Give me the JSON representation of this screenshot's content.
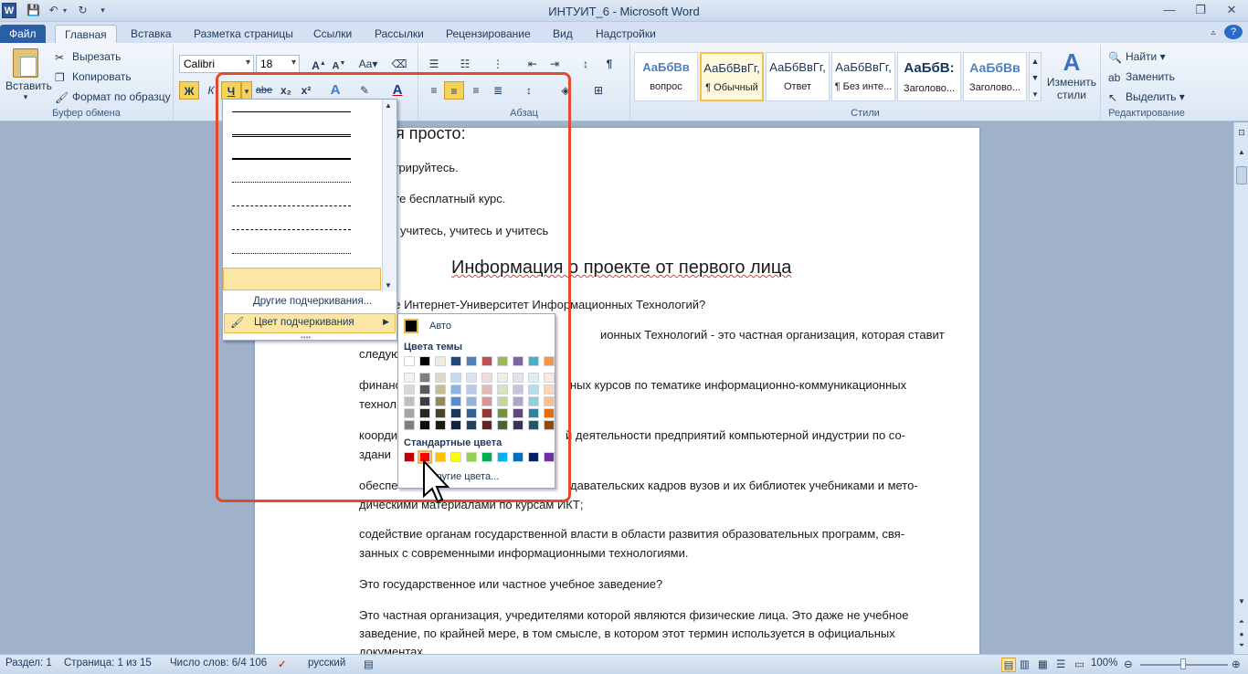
{
  "window": {
    "title": "ИНТУИТ_6 - Microsoft Word",
    "logo": "W"
  },
  "tabs": [
    {
      "label": "Файл",
      "kind": "file"
    },
    {
      "label": "Главная",
      "kind": "active"
    },
    {
      "label": "Вставка"
    },
    {
      "label": "Разметка страницы"
    },
    {
      "label": "Ссылки"
    },
    {
      "label": "Рассылки"
    },
    {
      "label": "Рецензирование"
    },
    {
      "label": "Вид"
    },
    {
      "label": "Надстройки"
    }
  ],
  "clipboard": {
    "paste": "Вставить",
    "cut": "Вырезать",
    "copy": "Копировать",
    "format_painter": "Формат по образцу",
    "group": "Буфер обмена"
  },
  "font": {
    "name": "Calibri",
    "size": "18",
    "bold": "Ж",
    "italic": "К",
    "underline": "Ч",
    "strike": "abe",
    "sub": "x₂",
    "sup": "x²"
  },
  "paragraph": {
    "group": "Абзац"
  },
  "styles": {
    "group": "Стили",
    "items": [
      {
        "sample": "АаБбВв",
        "name": "вопрос"
      },
      {
        "sample": "АаБбВвГг,",
        "name": "¶ Обычный",
        "selected": true
      },
      {
        "sample": "АаБбВвГг,",
        "name": "Ответ"
      },
      {
        "sample": "АаБбВвГг,",
        "name": "¶ Без инте..."
      },
      {
        "sample": "АаБбВ:",
        "name": "Заголово..."
      },
      {
        "sample": "АаБбВв",
        "name": "Заголово..."
      }
    ],
    "change_label_1": "Изменить",
    "change_label_2": "стили"
  },
  "editing": {
    "find": "Найти",
    "replace": "Заменить",
    "select": "Выделить",
    "group": "Редактирование"
  },
  "document": {
    "lines": [
      {
        "text": "ся просто:",
        "size": 18
      },
      {
        "text": "стрируйтесь."
      },
      {
        "text": "ите бесплатный курс."
      },
      {
        "text": "ь, учитесь, учитесь и учитесь"
      },
      {
        "text": "ое Интернет-Университет Информационных Технологий?"
      },
      {
        "text": "ионных Технологий - это частная организация, которая ставит"
      },
      {
        "text": "следую"
      },
      {
        "text": "финанс"
      },
      {
        "text": "ных курсов по тематике информационно-коммуникационных"
      },
      {
        "text": "технол"
      },
      {
        "text": "коорди"
      },
      {
        "text": "й деятельности предприятий компьютерной индустрии по со-"
      },
      {
        "text": "здани"
      },
      {
        "text": "обеспе"
      },
      {
        "text": "давательских кадров вузов и их библиотек учебниками и мето-"
      },
      {
        "text": "дическими материалами по курсам ИКТ;"
      },
      {
        "text": "содействие органам государственной власти в области развития образовательных программ, свя-"
      },
      {
        "text": "занных с современными информационными технологиями."
      },
      {
        "text": "Это государственное или частное учебное заведение?"
      },
      {
        "text": "Это частная организация, учредителями которой являются физические лица. Это даже не учебное"
      },
      {
        "text": "заведение, по крайней мере, в том смысле, в котором этот термин используется в официальных"
      },
      {
        "text": "документах"
      }
    ],
    "heading": "Информация о проекте от первого лица"
  },
  "underline_menu": {
    "more": "Другие подчеркивания...",
    "color": "Цвет подчеркивания"
  },
  "color_menu": {
    "auto": "Авто",
    "theme_title": "Цвета темы",
    "standard_title": "Стандартные цвета",
    "more": "Другие цвета...",
    "theme_top": [
      "#ffffff",
      "#000000",
      "#eeece1",
      "#1f497d",
      "#4f81bd",
      "#c0504d",
      "#9bbb59",
      "#8064a2",
      "#4bacc6",
      "#f79646"
    ],
    "theme_shades": [
      [
        "#f2f2f2",
        "#7f7f7f",
        "#ddd9c3",
        "#c6d9f0",
        "#dbe5f1",
        "#f2dcdb",
        "#ebf1dd",
        "#e5e0ec",
        "#dbeef3",
        "#fdeada"
      ],
      [
        "#d8d8d8",
        "#595959",
        "#c4bd97",
        "#8db3e2",
        "#b8cce4",
        "#e5b9b7",
        "#d7e3bc",
        "#ccc1d9",
        "#b7dde8",
        "#fbd5b5"
      ],
      [
        "#bfbfbf",
        "#3f3f3f",
        "#938953",
        "#548dd4",
        "#95b3d7",
        "#d99694",
        "#c3d69b",
        "#b2a2c7",
        "#92cddc",
        "#fac08f"
      ],
      [
        "#a5a5a5",
        "#262626",
        "#494429",
        "#17365d",
        "#366092",
        "#953734",
        "#76923c",
        "#5f497a",
        "#31859b",
        "#e36c09"
      ],
      [
        "#7f7f7f",
        "#0c0c0c",
        "#1d1b10",
        "#0f243e",
        "#244061",
        "#632423",
        "#4f6128",
        "#3f3151",
        "#205867",
        "#974806"
      ]
    ],
    "standard": [
      "#c00000",
      "#ff0000",
      "#ffc000",
      "#ffff00",
      "#92d050",
      "#00b050",
      "#00b0f0",
      "#0070c0",
      "#002060",
      "#7030a0"
    ]
  },
  "status": {
    "section": "Раздел: 1",
    "page": "Страница: 1 из 15",
    "words": "Число слов: 6/4 106",
    "lang": "русский",
    "zoom": "100%"
  }
}
